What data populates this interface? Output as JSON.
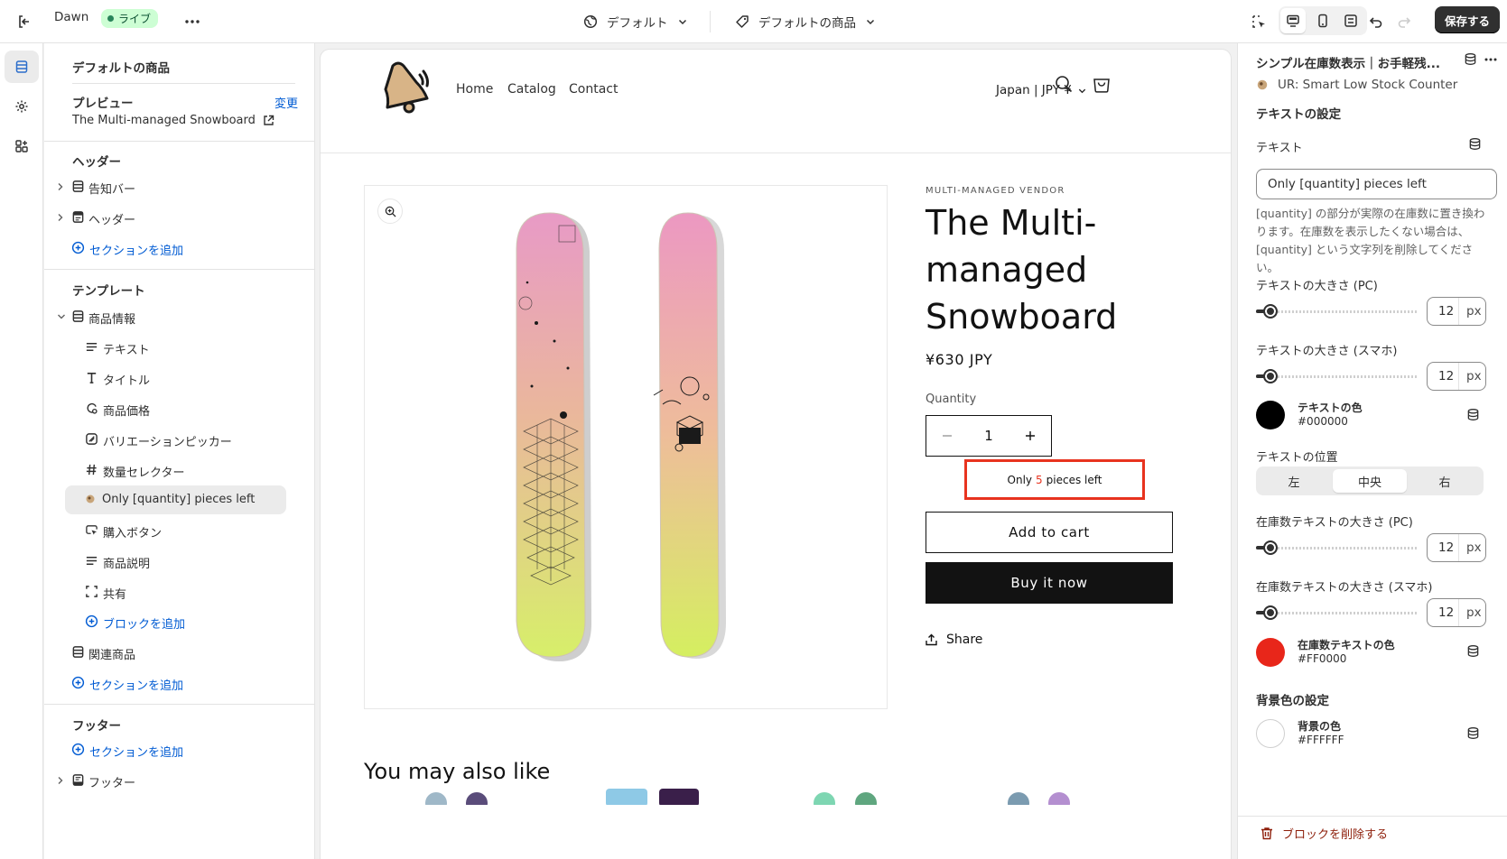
{
  "topbar": {
    "theme_name": "Dawn",
    "live_badge": "ライブ",
    "theme_select": "デフォルト",
    "template_select": "デフォルトの商品",
    "save_label": "保存する"
  },
  "left_panel": {
    "title": "デフォルトの商品",
    "preview_heading": "プレビュー",
    "preview_change": "変更",
    "preview_product": "The Multi-managed Snowboard",
    "header_heading": "ヘッダー",
    "header_items": [
      "告知バー",
      "ヘッダー"
    ],
    "add_section": "セクションを追加",
    "template_heading": "テンプレート",
    "product_info": "商品情報",
    "blocks": [
      "テキスト",
      "タイトル",
      "商品価格",
      "バリエーションピッカー",
      "数量セレクター",
      "Only [quantity] pieces left",
      "購入ボタン",
      "商品説明",
      "共有"
    ],
    "add_block": "ブロックを追加",
    "related": "関連商品",
    "footer_heading": "フッター",
    "footer_item": "フッター"
  },
  "store": {
    "nav": [
      "Home",
      "Catalog",
      "Contact"
    ],
    "locale": "Japan | JPY ¥",
    "vendor": "MULTI-MANAGED VENDOR",
    "title": "The Multi-managed Snowboard",
    "price": "¥630 JPY",
    "quantity_label": "Quantity",
    "quantity_value": "1",
    "stock_prefix": "Only",
    "stock_number": "5",
    "stock_suffix": "pieces left",
    "add_to_cart": "Add to cart",
    "buy_now": "Buy it now",
    "share": "Share",
    "also_like": "You may also like"
  },
  "right_panel": {
    "title": "シンプル在庫数表示｜お手軽残...",
    "app_name": "UR: Smart Low Stock Counter",
    "text_settings": "テキストの設定",
    "text_label": "テキスト",
    "text_value": "Only [quantity] pieces left",
    "help": "[quantity] の部分が実際の在庫数に置き換わります。在庫数を表示したくない場合は、[quantity] という文字列を削除してください。",
    "size_pc_label": "テキストの大きさ (PC)",
    "size_pc": "12",
    "size_sp_label": "テキストの大きさ (スマホ)",
    "size_sp": "12",
    "unit": "px",
    "text_color_label": "テキストの色",
    "text_color": "#000000",
    "position_label": "テキストの位置",
    "position_options": [
      "左",
      "中央",
      "右"
    ],
    "stock_size_pc_label": "在庫数テキストの大きさ (PC)",
    "stock_size_pc": "12",
    "stock_size_sp_label": "在庫数テキストの大きさ (スマホ)",
    "stock_size_sp": "12",
    "stock_color_label": "在庫数テキストの色",
    "stock_color": "#FF0000",
    "bg_settings": "背景色の設定",
    "bg_color_label": "背景の色",
    "bg_color": "#FFFFFF",
    "delete_block": "ブロックを削除する"
  },
  "colors": {
    "accent_blue": "#005bd3",
    "live_green": "#29845a",
    "stock_red": "#e8331f"
  }
}
